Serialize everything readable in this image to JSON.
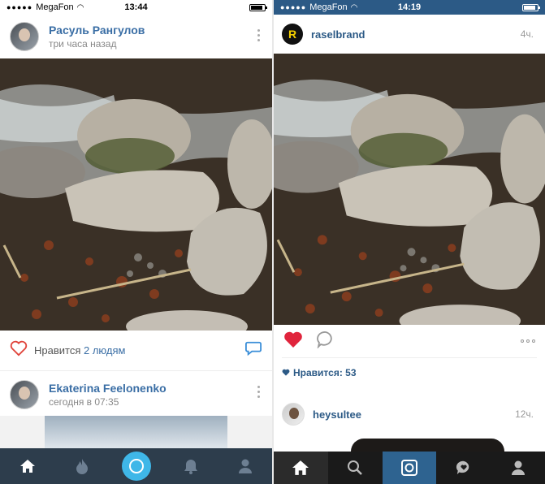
{
  "left": {
    "status": {
      "carrier": "MegaFon",
      "time": "13:44",
      "battery_level": 0.9
    },
    "post1": {
      "author": "Расуль Рангулов",
      "time": "три часа назад",
      "likes_prefix": "Нравится ",
      "likes_count": "2 людям"
    },
    "post2": {
      "author": "Ekaterina Feelonenko",
      "time": "сегодня в 07:35"
    },
    "tabs": [
      "home-icon",
      "fire-icon",
      "camera-icon",
      "bell-icon",
      "profile-icon"
    ],
    "colors": {
      "link": "#3a6ea5",
      "tabbar": "#2d3d4c",
      "camera": "#3fb7e8",
      "heart": "#e0453c"
    }
  },
  "right": {
    "status": {
      "carrier": "MegaFon",
      "time": "14:19",
      "battery_level": 0.9
    },
    "post1": {
      "author": "raselbrand",
      "logo_letter": "R",
      "time": "4ч.",
      "likes": "Нравится: 53"
    },
    "post2": {
      "author": "heysultee",
      "time": "12ч."
    },
    "tabs": [
      "home-icon",
      "search-icon",
      "camera-icon",
      "activity-icon",
      "profile-icon"
    ],
    "colors": {
      "statusbar": "#2c5a86",
      "name": "#2c5a86",
      "heart": "#e0243c",
      "tabbar": "#1a1a1a"
    }
  }
}
